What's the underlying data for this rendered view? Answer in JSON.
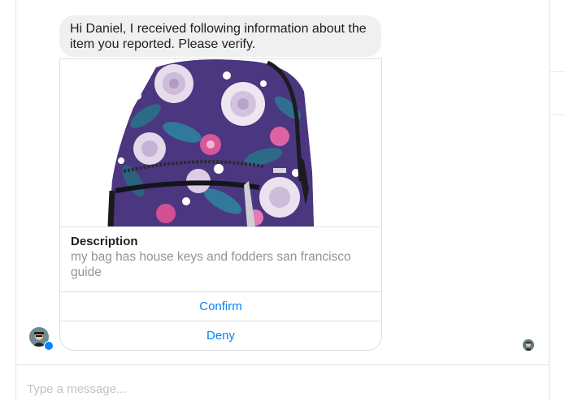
{
  "message": {
    "text": "Hi Daniel, I received following information about the item you reported. Please verify."
  },
  "card": {
    "image_alt": "floral backpack",
    "description_title": "Description",
    "description_text": "my bag has house keys and fodders san francisco guide",
    "buttons": [
      {
        "label": "Confirm"
      },
      {
        "label": "Deny"
      }
    ]
  },
  "composer": {
    "placeholder": "Type a message..."
  },
  "colors": {
    "accent": "#0084ff",
    "bubble_bg": "#f1f0f0",
    "muted_text": "#90949c"
  }
}
